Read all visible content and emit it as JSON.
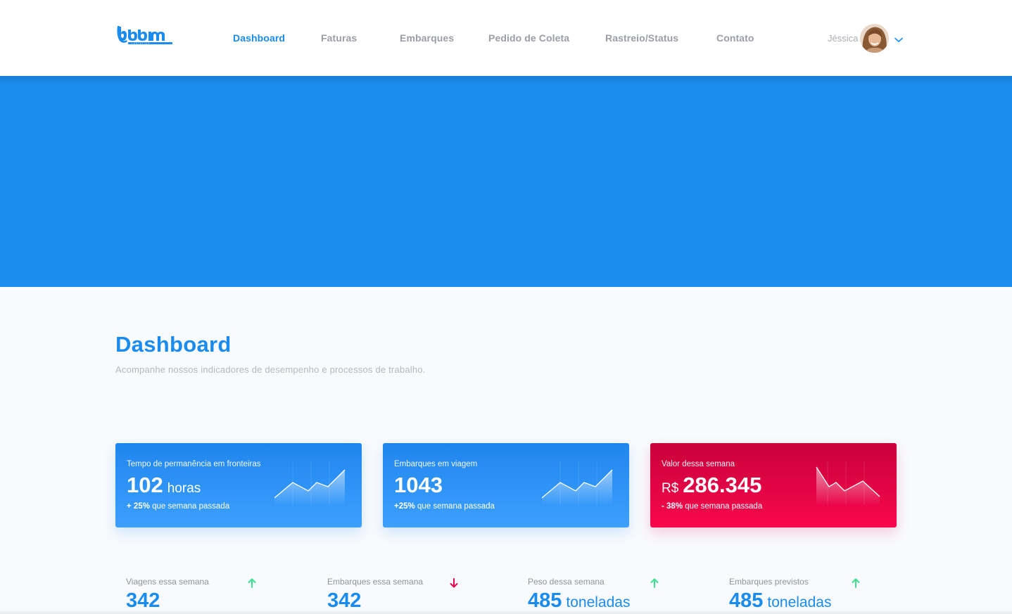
{
  "header": {
    "logo_text": "bbm logística",
    "nav": [
      {
        "label": "Dashboard",
        "active": true
      },
      {
        "label": "Faturas",
        "active": false
      },
      {
        "label": "Embarques",
        "active": false
      },
      {
        "label": "Pedido de Coleta",
        "active": false
      },
      {
        "label": "Rastreio/Status",
        "active": false
      },
      {
        "label": "Contato",
        "active": false
      }
    ],
    "user_name": "Jéssica",
    "avatar_icon": "user-avatar",
    "menu_icon": "chevron-down-icon"
  },
  "hero": {
    "color": "#1a8cef"
  },
  "page": {
    "title": "Dashboard",
    "subtitle": "Acompanhe nossos indicadores de desempenho e processos de trabalho."
  },
  "cards": [
    {
      "label": "Tempo de permanência em fronteiras",
      "prefix": "",
      "value": "102",
      "unit": "horas",
      "change_bold": "+ 25%",
      "change_text": "que semana passada",
      "theme": "blue",
      "icon": "sparkline-up-icon"
    },
    {
      "label": "Embarques em viagem",
      "prefix": "",
      "value": "1043",
      "unit": "",
      "change_bold": "+25%",
      "change_text": "que semana passada",
      "theme": "blue",
      "icon": "sparkline-up-icon"
    },
    {
      "label": "Valor dessa semana",
      "prefix": "R$",
      "value": "286.345",
      "unit": "",
      "change_bold": "- 38%",
      "change_text": "que semana passada",
      "theme": "red",
      "icon": "sparkline-down-icon"
    }
  ],
  "stats": [
    {
      "label": "Viagens essa semana",
      "value": "342",
      "unit": "",
      "trend": "up",
      "icon": "arrow-up-icon"
    },
    {
      "label": "Embarques essa semana",
      "value": "342",
      "unit": "",
      "trend": "down",
      "icon": "arrow-down-icon"
    },
    {
      "label": "Peso dessa semana",
      "value": "485",
      "unit": "toneladas",
      "trend": "up",
      "icon": "arrow-up-icon"
    },
    {
      "label": "Embarques previstos",
      "value": "485",
      "unit": "toneladas",
      "trend": "up",
      "icon": "arrow-up-icon"
    }
  ],
  "colors": {
    "accent": "#1a8cef",
    "positive": "#3ee08f",
    "negative": "#e8044a",
    "card_red": "#e8044a"
  }
}
